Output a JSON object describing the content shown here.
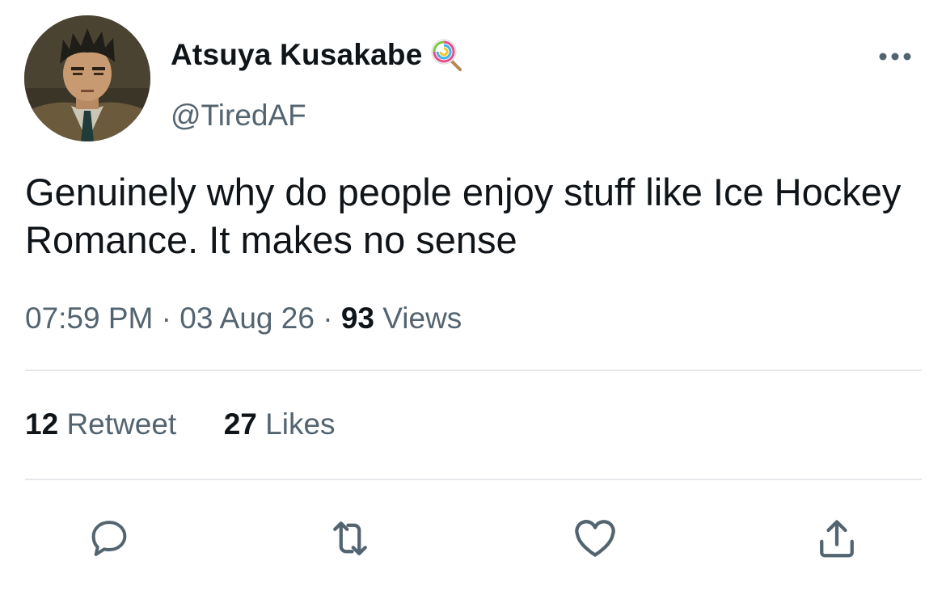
{
  "author": {
    "display_name": "Atsuya Kusakabe",
    "handle": "@TiredAF",
    "badge_icon": "lollipop-emoji"
  },
  "tweet": {
    "text": "Genuinely why do people enjoy stuff like Ice Hockey Romance. It makes no sense",
    "time": "07:59 PM",
    "separator": "·",
    "date": "03 Aug 26",
    "views_count": "93",
    "views_label": "Views"
  },
  "stats": {
    "retweets_count": "12",
    "retweets_label": "Retweet",
    "likes_count": "27",
    "likes_label": "Likes"
  },
  "actions": [
    {
      "icon": "reply-icon"
    },
    {
      "icon": "retweet-icon"
    },
    {
      "icon": "like-icon"
    },
    {
      "icon": "share-icon"
    }
  ],
  "colors": {
    "text_primary": "#0f1419",
    "text_secondary": "#536471",
    "divider": "#e6e9eb",
    "icon": "#536471"
  }
}
